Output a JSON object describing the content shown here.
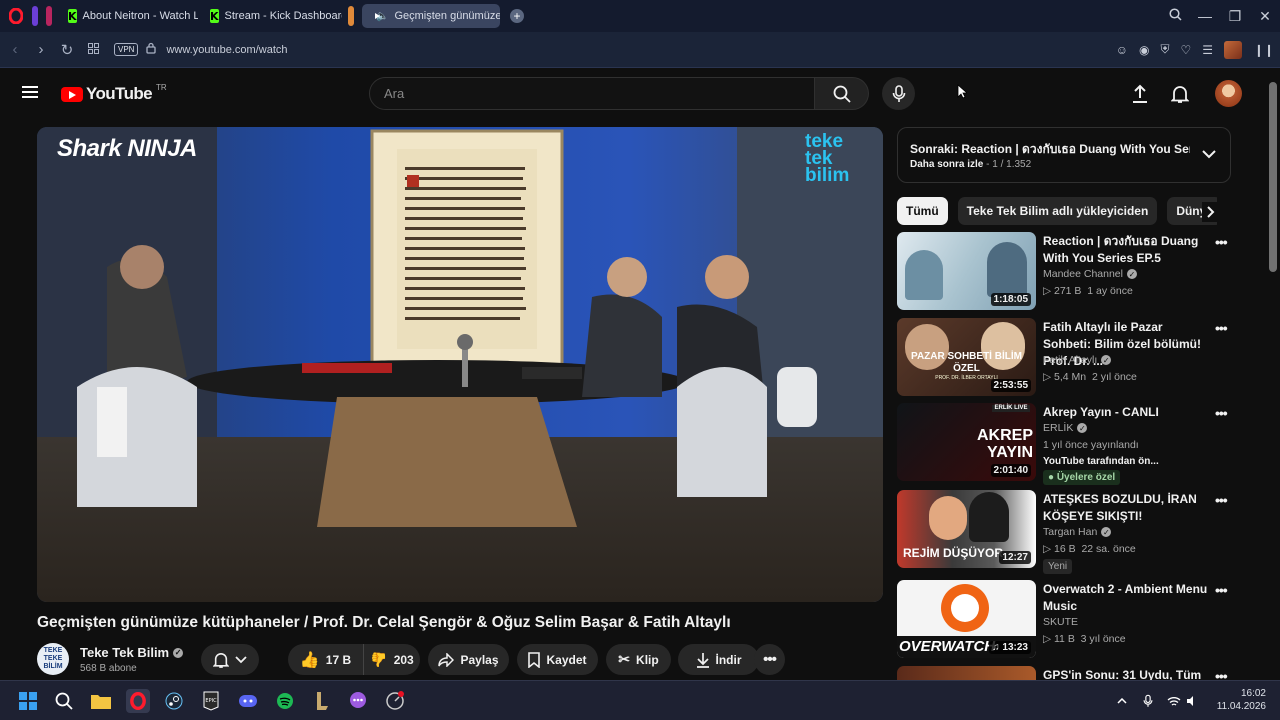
{
  "browser": {
    "tabs": [
      {
        "label": "About Neitron - Watch Liv",
        "icon": "kick-icon"
      },
      {
        "label": "Stream - Kick Dashboard",
        "icon": "kick-icon"
      },
      {
        "label": "Geçmişten günümüze",
        "icon": "youtube-icon",
        "active": true
      }
    ],
    "vpn_label": "VPN",
    "url": "www.youtube.com/watch"
  },
  "youtube": {
    "logo_text": "YouTube",
    "country": "TR",
    "search_placeholder": "Ara"
  },
  "video": {
    "title": "Geçmişten günümüze kütüphaneler / Prof. Dr. Celal Şengör & Oğuz Selim Başar & Fatih Altaylı",
    "channel_name": "Teke Tek Bilim",
    "channel_avatar_text": "TEKE TEKE BİLİM",
    "subscribers": "568 B abone",
    "likes": "17 B",
    "dislikes": "203",
    "share_label": "Paylaş",
    "save_label": "Kaydet",
    "clip_label": "Klip",
    "download_label": "İndir",
    "sponsor_logo": "Shark NINJA",
    "channel_watermark": "teke tek bilim"
  },
  "up_next": {
    "title": "Sonraki: Reaction | ดวงกับเธอ Duang With You Serie...",
    "playlist": "Daha sonra izle",
    "position": "1 / 1.352"
  },
  "chips": [
    "Tümü",
    "Teke Tek Bilim adlı yükleyiciden",
    "Dünya"
  ],
  "recommendations": [
    {
      "title": "Reaction | ดวงกับเธอ Duang With You Series EP.5",
      "channel": "Mandee Channel",
      "verified": true,
      "views": "271 B",
      "age": "1 ay önce",
      "duration": "1:18:05"
    },
    {
      "title": "Fatih Altaylı ile Pazar Sohbeti: Bilim özel bölümü! Prof. Dr. ...",
      "channel": "Fatih Altaylı",
      "verified": true,
      "views": "5,4 Mn",
      "age": "2 yıl önce",
      "duration": "2:53:55",
      "thumb_text": "PAZAR SOHBETİ BİLİM ÖZEL",
      "thumb_sub": "PROF. DR. İLBER ORTAYLI"
    },
    {
      "title": "Akrep Yayın - CANLI",
      "channel": "ERLİK",
      "verified": true,
      "meta1": "1 yıl önce yayınlandı",
      "meta2": "YouTube tarafından ön...",
      "badge": "Üyelere özel",
      "duration": "2:01:40",
      "thumb_text": "AKREP YAYIN",
      "thumb_sub": "ERLİK LIVE"
    },
    {
      "title": "ATEŞKES BOZULDU, İRAN KÖŞEYE SIKIŞTI!",
      "channel": "Targan Han",
      "verified": true,
      "views": "16 B",
      "age": "22 sa. önce",
      "badge": "Yeni",
      "duration": "12:27",
      "thumb_text": "REJİM DÜŞÜYOR"
    },
    {
      "title": "Overwatch 2 - Ambient Menu Music",
      "channel": "SKUTE",
      "verified": false,
      "views": "11 B",
      "age": "3 yıl önce",
      "duration": "13:23",
      "thumb_text": "OVERWATCH"
    },
    {
      "title": "GPS'in Sonu: 31 Uydu, Tüm",
      "duration": ""
    }
  ],
  "taskbar": {
    "time": "16:02",
    "date": "11.04.2026"
  },
  "colors": {
    "yt_red": "#ff0000",
    "background": "#0f0f0f",
    "chip_bg": "#272727",
    "kick_green": "#53fc18"
  }
}
